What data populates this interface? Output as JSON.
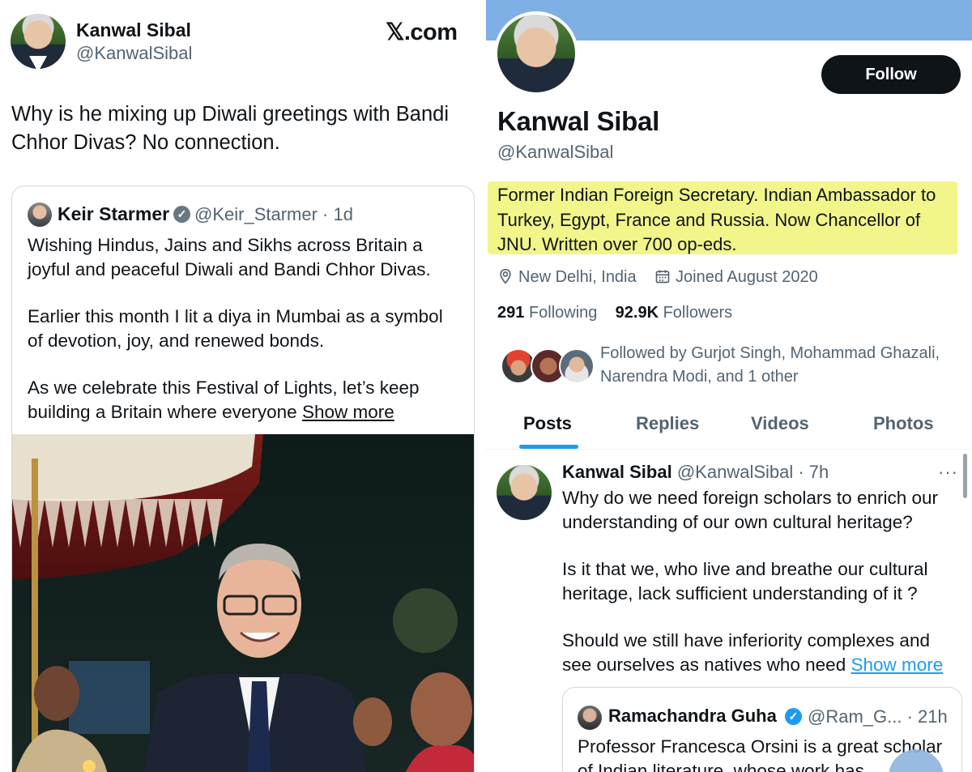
{
  "left": {
    "author_name": "Kanwal Sibal",
    "author_handle": "@KanwalSibal",
    "site_logo": "𝕏.com",
    "tweet_text": "Why is he mixing up Diwali greetings with Bandi Chhor Divas?  No connection.",
    "quote": {
      "name": "Keir Starmer",
      "handle": "@Keir_Starmer · 1d",
      "paragraphs": [
        "Wishing Hindus, Jains and Sikhs across Britain a joyful and peaceful Diwali and Bandi Chhor Divas.",
        "Earlier this month I lit a diya in Mumbai as a symbol of devotion, joy, and renewed bonds.",
        "As we celebrate this Festival of Lights, let’s keep building a Britain where everyone"
      ],
      "show_more": "Show more"
    }
  },
  "right": {
    "follow_label": "Follow",
    "name": "Kanwal Sibal",
    "handle": "@KanwalSibal",
    "bio": "Former Indian Foreign Secretary. Indian Ambassador to Turkey, Egypt, France and Russia. Now Chancellor of JNU. Written over 700 op-eds.",
    "location": "New Delhi, India",
    "joined": "Joined August 2020",
    "following_count": "291",
    "following_label": "Following",
    "followers_count": "92.9K",
    "followers_label": "Followers",
    "followed_by": "Followed by Gurjot Singh, Mohammad Ghazali, Narendra Modi, and 1 other",
    "tabs": [
      "Posts",
      "Replies",
      "Videos",
      "Photos"
    ],
    "post": {
      "name": "Kanwal Sibal",
      "handle": "@KanwalSibal · 7h",
      "more": "···",
      "paragraphs": [
        "Why do we need foreign scholars to enrich our understanding of our own cultural heritage?",
        "Is  it that we, who live and breathe our cultural heritage, lack sufficient understanding of it ?",
        "Should we still have inferiority complexes and see ourselves as natives who need"
      ],
      "show_more": "Show more",
      "quote": {
        "name": "Ramachandra Guha",
        "handle": "@Ram_G... · 21h",
        "text": "Professor Francesca Orsini is a great scholar of Indian literature, whose work has"
      }
    }
  },
  "colors": {
    "banner": "#7eb0e6",
    "highlight": "#f1f58a",
    "tab_indicator": "#1d9bf0",
    "verified_grey": "#6b7780",
    "verified_blue": "#1d9bf0"
  }
}
